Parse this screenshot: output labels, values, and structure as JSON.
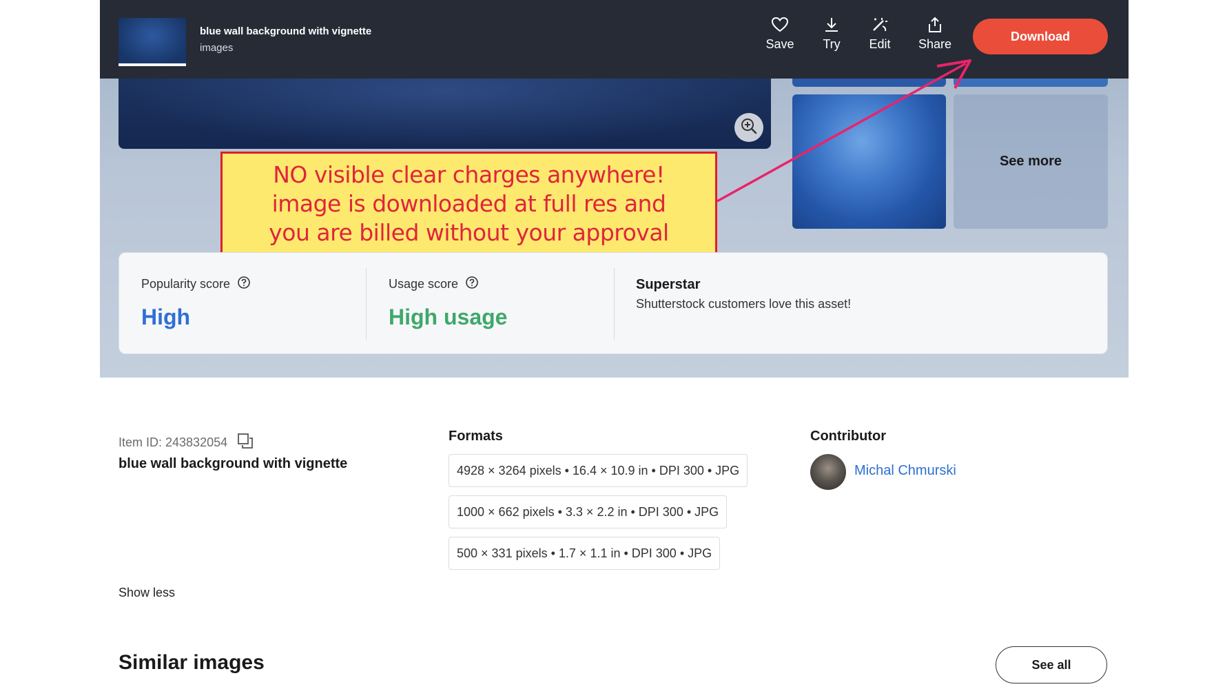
{
  "topbar": {
    "title": "blue wall background with vignette",
    "subtitle": "images",
    "actions": [
      {
        "label": "Save",
        "icon": "heart-icon"
      },
      {
        "label": "Try",
        "icon": "download-arrow-icon"
      },
      {
        "label": "Edit",
        "icon": "edit-wand-icon"
      },
      {
        "label": "Share",
        "icon": "share-icon"
      }
    ],
    "download_label": "Download"
  },
  "gallery": {
    "see_more_label": "See more"
  },
  "annotation": {
    "text": "NO visible clear charges anywhere!\nimage is downloaded at full res and\nyou are billed without your approval"
  },
  "scores": {
    "popularity": {
      "label": "Popularity score",
      "value": "High"
    },
    "usage": {
      "label": "Usage score",
      "value": "High usage"
    },
    "superstar": {
      "title": "Superstar",
      "text": "Shutterstock customers love this asset!"
    }
  },
  "details": {
    "item_id": "Item ID: 243832054",
    "title": "blue wall background with vignette",
    "show_less": "Show less"
  },
  "formats": {
    "title": "Formats",
    "items": [
      "4928 × 3264 pixels • 16.4 × 10.9 in • DPI 300 • JPG",
      "1000 × 662 pixels • 3.3 × 2.2 in • DPI 300 • JPG",
      "500 × 331 pixels • 1.7 × 1.1 in • DPI 300 • JPG"
    ]
  },
  "contributor": {
    "title": "Contributor",
    "name": "Michal Chmurski"
  },
  "similar": {
    "title": "Similar images",
    "see_all": "See all"
  },
  "colors": {
    "topbar": "#262b36",
    "download": "#ea4d3a",
    "popularity_value": "#2f6fd6",
    "usage_value": "#3fa86a",
    "annotation_fill": "#fde96e",
    "annotation_border": "#e11d2a",
    "arrow": "#e8246b"
  }
}
